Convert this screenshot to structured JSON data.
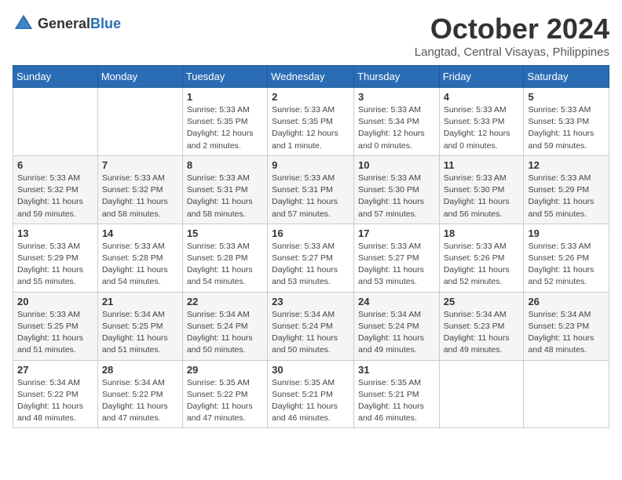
{
  "header": {
    "logo_general": "General",
    "logo_blue": "Blue",
    "month": "October 2024",
    "location": "Langtad, Central Visayas, Philippines"
  },
  "weekdays": [
    "Sunday",
    "Monday",
    "Tuesday",
    "Wednesday",
    "Thursday",
    "Friday",
    "Saturday"
  ],
  "weeks": [
    [
      {
        "day": "",
        "text": ""
      },
      {
        "day": "",
        "text": ""
      },
      {
        "day": "1",
        "text": "Sunrise: 5:33 AM\nSunset: 5:35 PM\nDaylight: 12 hours\nand 2 minutes."
      },
      {
        "day": "2",
        "text": "Sunrise: 5:33 AM\nSunset: 5:35 PM\nDaylight: 12 hours\nand 1 minute."
      },
      {
        "day": "3",
        "text": "Sunrise: 5:33 AM\nSunset: 5:34 PM\nDaylight: 12 hours\nand 0 minutes."
      },
      {
        "day": "4",
        "text": "Sunrise: 5:33 AM\nSunset: 5:33 PM\nDaylight: 12 hours\nand 0 minutes."
      },
      {
        "day": "5",
        "text": "Sunrise: 5:33 AM\nSunset: 5:33 PM\nDaylight: 11 hours\nand 59 minutes."
      }
    ],
    [
      {
        "day": "6",
        "text": "Sunrise: 5:33 AM\nSunset: 5:32 PM\nDaylight: 11 hours\nand 59 minutes."
      },
      {
        "day": "7",
        "text": "Sunrise: 5:33 AM\nSunset: 5:32 PM\nDaylight: 11 hours\nand 58 minutes."
      },
      {
        "day": "8",
        "text": "Sunrise: 5:33 AM\nSunset: 5:31 PM\nDaylight: 11 hours\nand 58 minutes."
      },
      {
        "day": "9",
        "text": "Sunrise: 5:33 AM\nSunset: 5:31 PM\nDaylight: 11 hours\nand 57 minutes."
      },
      {
        "day": "10",
        "text": "Sunrise: 5:33 AM\nSunset: 5:30 PM\nDaylight: 11 hours\nand 57 minutes."
      },
      {
        "day": "11",
        "text": "Sunrise: 5:33 AM\nSunset: 5:30 PM\nDaylight: 11 hours\nand 56 minutes."
      },
      {
        "day": "12",
        "text": "Sunrise: 5:33 AM\nSunset: 5:29 PM\nDaylight: 11 hours\nand 55 minutes."
      }
    ],
    [
      {
        "day": "13",
        "text": "Sunrise: 5:33 AM\nSunset: 5:29 PM\nDaylight: 11 hours\nand 55 minutes."
      },
      {
        "day": "14",
        "text": "Sunrise: 5:33 AM\nSunset: 5:28 PM\nDaylight: 11 hours\nand 54 minutes."
      },
      {
        "day": "15",
        "text": "Sunrise: 5:33 AM\nSunset: 5:28 PM\nDaylight: 11 hours\nand 54 minutes."
      },
      {
        "day": "16",
        "text": "Sunrise: 5:33 AM\nSunset: 5:27 PM\nDaylight: 11 hours\nand 53 minutes."
      },
      {
        "day": "17",
        "text": "Sunrise: 5:33 AM\nSunset: 5:27 PM\nDaylight: 11 hours\nand 53 minutes."
      },
      {
        "day": "18",
        "text": "Sunrise: 5:33 AM\nSunset: 5:26 PM\nDaylight: 11 hours\nand 52 minutes."
      },
      {
        "day": "19",
        "text": "Sunrise: 5:33 AM\nSunset: 5:26 PM\nDaylight: 11 hours\nand 52 minutes."
      }
    ],
    [
      {
        "day": "20",
        "text": "Sunrise: 5:33 AM\nSunset: 5:25 PM\nDaylight: 11 hours\nand 51 minutes."
      },
      {
        "day": "21",
        "text": "Sunrise: 5:34 AM\nSunset: 5:25 PM\nDaylight: 11 hours\nand 51 minutes."
      },
      {
        "day": "22",
        "text": "Sunrise: 5:34 AM\nSunset: 5:24 PM\nDaylight: 11 hours\nand 50 minutes."
      },
      {
        "day": "23",
        "text": "Sunrise: 5:34 AM\nSunset: 5:24 PM\nDaylight: 11 hours\nand 50 minutes."
      },
      {
        "day": "24",
        "text": "Sunrise: 5:34 AM\nSunset: 5:24 PM\nDaylight: 11 hours\nand 49 minutes."
      },
      {
        "day": "25",
        "text": "Sunrise: 5:34 AM\nSunset: 5:23 PM\nDaylight: 11 hours\nand 49 minutes."
      },
      {
        "day": "26",
        "text": "Sunrise: 5:34 AM\nSunset: 5:23 PM\nDaylight: 11 hours\nand 48 minutes."
      }
    ],
    [
      {
        "day": "27",
        "text": "Sunrise: 5:34 AM\nSunset: 5:22 PM\nDaylight: 11 hours\nand 48 minutes."
      },
      {
        "day": "28",
        "text": "Sunrise: 5:34 AM\nSunset: 5:22 PM\nDaylight: 11 hours\nand 47 minutes."
      },
      {
        "day": "29",
        "text": "Sunrise: 5:35 AM\nSunset: 5:22 PM\nDaylight: 11 hours\nand 47 minutes."
      },
      {
        "day": "30",
        "text": "Sunrise: 5:35 AM\nSunset: 5:21 PM\nDaylight: 11 hours\nand 46 minutes."
      },
      {
        "day": "31",
        "text": "Sunrise: 5:35 AM\nSunset: 5:21 PM\nDaylight: 11 hours\nand 46 minutes."
      },
      {
        "day": "",
        "text": ""
      },
      {
        "day": "",
        "text": ""
      }
    ]
  ]
}
